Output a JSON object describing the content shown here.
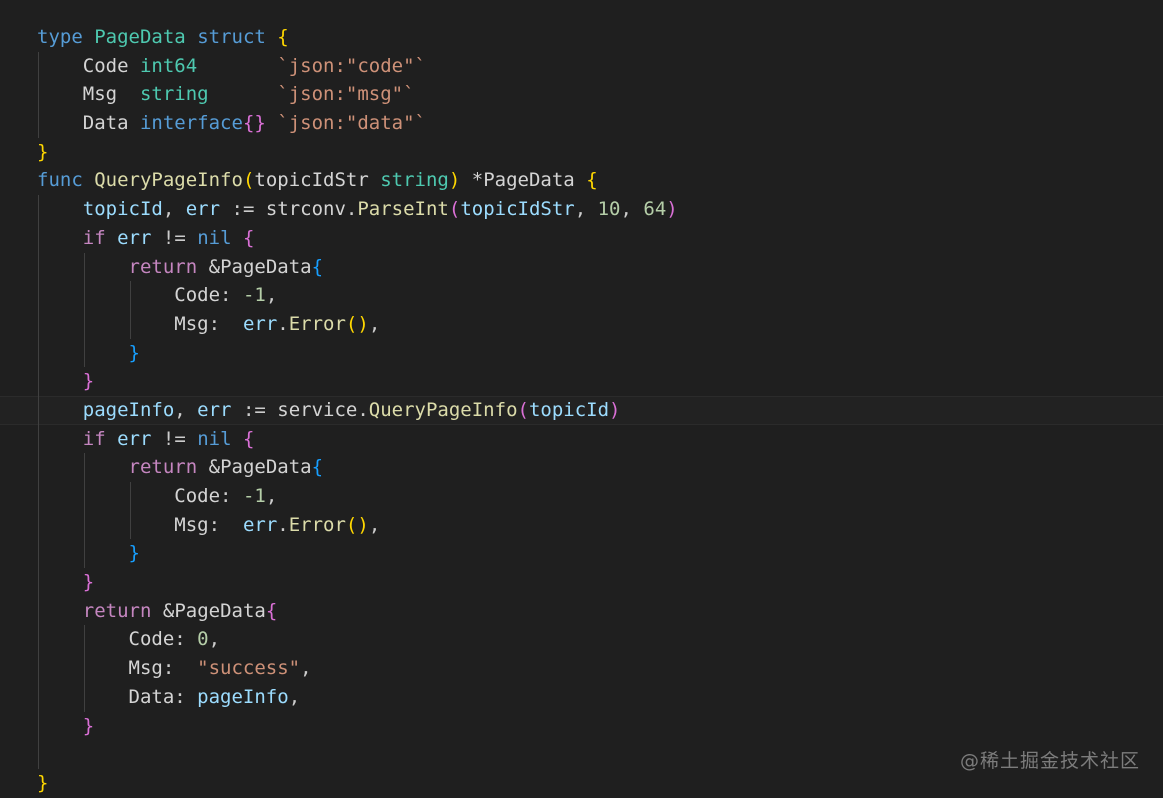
{
  "theme": {
    "background": "#1f1f1f",
    "current_line": "#222222",
    "indent_guide": "#404040",
    "colors": {
      "keyword": "#569cd6",
      "control": "#c586c0",
      "type": "#4ec9b0",
      "func": "#dcdcaa",
      "var": "#9cdcfe",
      "field": "#d4d4d4",
      "plain": "#cccccc",
      "string": "#ce9178",
      "number": "#b5cea8",
      "bracket1": "#ffd700",
      "bracket2": "#da70d6",
      "bracket3": "#179fff"
    }
  },
  "editor": {
    "lines": [
      {
        "indent": 0,
        "tokens": [
          {
            "t": "type",
            "c": "keyword"
          },
          {
            "t": " ",
            "c": "plain"
          },
          {
            "t": "PageData",
            "c": "type"
          },
          {
            "t": " ",
            "c": "plain"
          },
          {
            "t": "struct",
            "c": "keyword"
          },
          {
            "t": " ",
            "c": "plain"
          },
          {
            "t": "{",
            "c": "bracket1"
          }
        ]
      },
      {
        "indent": 1,
        "tokens": [
          {
            "t": "Code",
            "c": "field"
          },
          {
            "t": " ",
            "c": "plain"
          },
          {
            "t": "int64",
            "c": "type"
          },
          {
            "t": "       ",
            "c": "plain"
          },
          {
            "t": "`json:\"code\"`",
            "c": "string"
          }
        ]
      },
      {
        "indent": 1,
        "tokens": [
          {
            "t": "Msg",
            "c": "field"
          },
          {
            "t": "  ",
            "c": "plain"
          },
          {
            "t": "string",
            "c": "type"
          },
          {
            "t": "      ",
            "c": "plain"
          },
          {
            "t": "`json:\"msg\"`",
            "c": "string"
          }
        ]
      },
      {
        "indent": 1,
        "tokens": [
          {
            "t": "Data",
            "c": "field"
          },
          {
            "t": " ",
            "c": "plain"
          },
          {
            "t": "interface",
            "c": "keyword"
          },
          {
            "t": "{}",
            "c": "bracket2"
          },
          {
            "t": " ",
            "c": "plain"
          },
          {
            "t": "`json:\"data\"`",
            "c": "string"
          }
        ]
      },
      {
        "indent": 0,
        "tokens": [
          {
            "t": "}",
            "c": "bracket1"
          }
        ]
      },
      {
        "indent": 0,
        "tokens": [
          {
            "t": "func",
            "c": "keyword"
          },
          {
            "t": " ",
            "c": "plain"
          },
          {
            "t": "QueryPageInfo",
            "c": "func"
          },
          {
            "t": "(",
            "c": "bracket1"
          },
          {
            "t": "topicIdStr",
            "c": "field"
          },
          {
            "t": " ",
            "c": "plain"
          },
          {
            "t": "string",
            "c": "type"
          },
          {
            "t": ")",
            "c": "bracket1"
          },
          {
            "t": " ",
            "c": "plain"
          },
          {
            "t": "*",
            "c": "field"
          },
          {
            "t": "PageData",
            "c": "field"
          },
          {
            "t": " ",
            "c": "plain"
          },
          {
            "t": "{",
            "c": "bracket1"
          }
        ]
      },
      {
        "indent": 1,
        "tokens": [
          {
            "t": "topicId",
            "c": "var"
          },
          {
            "t": ", ",
            "c": "plain"
          },
          {
            "t": "err",
            "c": "var"
          },
          {
            "t": " := ",
            "c": "plain"
          },
          {
            "t": "strconv",
            "c": "field"
          },
          {
            "t": ".",
            "c": "plain"
          },
          {
            "t": "ParseInt",
            "c": "func"
          },
          {
            "t": "(",
            "c": "bracket2"
          },
          {
            "t": "topicIdStr",
            "c": "var"
          },
          {
            "t": ", ",
            "c": "plain"
          },
          {
            "t": "10",
            "c": "number"
          },
          {
            "t": ", ",
            "c": "plain"
          },
          {
            "t": "64",
            "c": "number"
          },
          {
            "t": ")",
            "c": "bracket2"
          }
        ]
      },
      {
        "indent": 1,
        "tokens": [
          {
            "t": "if",
            "c": "control"
          },
          {
            "t": " ",
            "c": "plain"
          },
          {
            "t": "err",
            "c": "var"
          },
          {
            "t": " != ",
            "c": "plain"
          },
          {
            "t": "nil",
            "c": "keyword"
          },
          {
            "t": " ",
            "c": "plain"
          },
          {
            "t": "{",
            "c": "bracket2"
          }
        ]
      },
      {
        "indent": 2,
        "tokens": [
          {
            "t": "return",
            "c": "control"
          },
          {
            "t": " ",
            "c": "plain"
          },
          {
            "t": "&",
            "c": "field"
          },
          {
            "t": "PageData",
            "c": "field"
          },
          {
            "t": "{",
            "c": "bracket3"
          }
        ]
      },
      {
        "indent": 3,
        "tokens": [
          {
            "t": "Code",
            "c": "field"
          },
          {
            "t": ": ",
            "c": "plain"
          },
          {
            "t": "-1",
            "c": "number"
          },
          {
            "t": ",",
            "c": "plain"
          }
        ]
      },
      {
        "indent": 3,
        "tokens": [
          {
            "t": "Msg",
            "c": "field"
          },
          {
            "t": ":  ",
            "c": "plain"
          },
          {
            "t": "err",
            "c": "var"
          },
          {
            "t": ".",
            "c": "plain"
          },
          {
            "t": "Error",
            "c": "func"
          },
          {
            "t": "()",
            "c": "bracket1"
          },
          {
            "t": ",",
            "c": "plain"
          }
        ]
      },
      {
        "indent": 2,
        "tokens": [
          {
            "t": "}",
            "c": "bracket3"
          }
        ]
      },
      {
        "indent": 1,
        "tokens": [
          {
            "t": "}",
            "c": "bracket2"
          }
        ]
      },
      {
        "indent": 1,
        "current": true,
        "tokens": [
          {
            "t": "pageInfo",
            "c": "var"
          },
          {
            "t": ", ",
            "c": "plain"
          },
          {
            "t": "err",
            "c": "var"
          },
          {
            "t": " := ",
            "c": "plain"
          },
          {
            "t": "service",
            "c": "field"
          },
          {
            "t": ".",
            "c": "plain"
          },
          {
            "t": "QueryPageInfo",
            "c": "func"
          },
          {
            "t": "(",
            "c": "bracket2"
          },
          {
            "t": "topicId",
            "c": "var"
          },
          {
            "t": ")",
            "c": "bracket2"
          }
        ]
      },
      {
        "indent": 1,
        "tokens": [
          {
            "t": "if",
            "c": "control"
          },
          {
            "t": " ",
            "c": "plain"
          },
          {
            "t": "err",
            "c": "var"
          },
          {
            "t": " != ",
            "c": "plain"
          },
          {
            "t": "nil",
            "c": "keyword"
          },
          {
            "t": " ",
            "c": "plain"
          },
          {
            "t": "{",
            "c": "bracket2"
          }
        ]
      },
      {
        "indent": 2,
        "tokens": [
          {
            "t": "return",
            "c": "control"
          },
          {
            "t": " ",
            "c": "plain"
          },
          {
            "t": "&",
            "c": "field"
          },
          {
            "t": "PageData",
            "c": "field"
          },
          {
            "t": "{",
            "c": "bracket3"
          }
        ]
      },
      {
        "indent": 3,
        "tokens": [
          {
            "t": "Code",
            "c": "field"
          },
          {
            "t": ": ",
            "c": "plain"
          },
          {
            "t": "-1",
            "c": "number"
          },
          {
            "t": ",",
            "c": "plain"
          }
        ]
      },
      {
        "indent": 3,
        "tokens": [
          {
            "t": "Msg",
            "c": "field"
          },
          {
            "t": ":  ",
            "c": "plain"
          },
          {
            "t": "err",
            "c": "var"
          },
          {
            "t": ".",
            "c": "plain"
          },
          {
            "t": "Error",
            "c": "func"
          },
          {
            "t": "()",
            "c": "bracket1"
          },
          {
            "t": ",",
            "c": "plain"
          }
        ]
      },
      {
        "indent": 2,
        "tokens": [
          {
            "t": "}",
            "c": "bracket3"
          }
        ]
      },
      {
        "indent": 1,
        "tokens": [
          {
            "t": "}",
            "c": "bracket2"
          }
        ]
      },
      {
        "indent": 1,
        "tokens": [
          {
            "t": "return",
            "c": "control"
          },
          {
            "t": " ",
            "c": "plain"
          },
          {
            "t": "&",
            "c": "field"
          },
          {
            "t": "PageData",
            "c": "field"
          },
          {
            "t": "{",
            "c": "bracket2"
          }
        ]
      },
      {
        "indent": 2,
        "tokens": [
          {
            "t": "Code",
            "c": "field"
          },
          {
            "t": ": ",
            "c": "plain"
          },
          {
            "t": "0",
            "c": "number"
          },
          {
            "t": ",",
            "c": "plain"
          }
        ]
      },
      {
        "indent": 2,
        "tokens": [
          {
            "t": "Msg",
            "c": "field"
          },
          {
            "t": ":  ",
            "c": "plain"
          },
          {
            "t": "\"success\"",
            "c": "string"
          },
          {
            "t": ",",
            "c": "plain"
          }
        ]
      },
      {
        "indent": 2,
        "tokens": [
          {
            "t": "Data",
            "c": "field"
          },
          {
            "t": ": ",
            "c": "plain"
          },
          {
            "t": "pageInfo",
            "c": "var"
          },
          {
            "t": ",",
            "c": "plain"
          }
        ]
      },
      {
        "indent": 1,
        "tokens": [
          {
            "t": "}",
            "c": "bracket2"
          }
        ]
      },
      {
        "indent": 1,
        "guides_only": true,
        "tokens": []
      },
      {
        "indent": 0,
        "tokens": [
          {
            "t": "}",
            "c": "bracket1"
          }
        ]
      }
    ]
  },
  "watermark": {
    "text": "@稀土掘金技术社区"
  }
}
